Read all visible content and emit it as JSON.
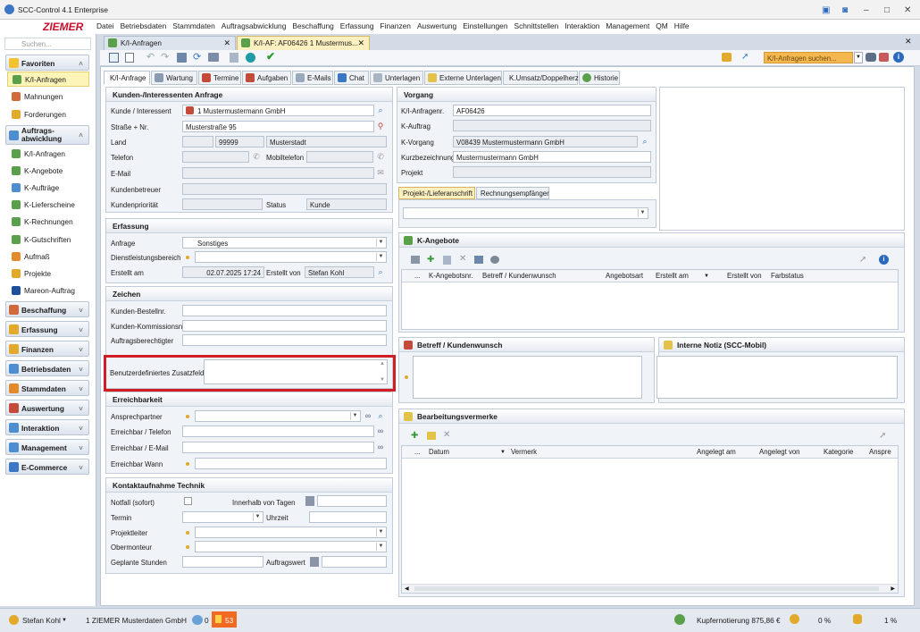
{
  "window": {
    "title": "SCC-Control 4.1 Enterprise"
  },
  "logo": "ZIEMER",
  "menu": [
    "Datei",
    "Betriebsdaten",
    "Stammdaten",
    "Auftragsabwicklung",
    "Beschaffung",
    "Erfassung",
    "Finanzen",
    "Auswertung",
    "Einstellungen",
    "Schnittstellen",
    "Interaktion",
    "Management",
    "QM",
    "Hilfe"
  ],
  "sidebar": {
    "search_placeholder": "Suchen...",
    "favoriten": "Favoriten",
    "fav_items": [
      "K/I-Anfragen",
      "Mahnungen",
      "Forderungen"
    ],
    "auftrag": "Auftrags-\nabwicklung",
    "auftrag_items": [
      "K/I-Anfragen",
      "K-Angebote",
      "K-Aufträge",
      "K-Lieferscheine",
      "K-Rechnungen",
      "K-Gutschriften",
      "Aufmaß",
      "Projekte",
      "Mareon-Auftrag"
    ],
    "groups": [
      "Beschaffung",
      "Erfassung",
      "Finanzen",
      "Betriebsdaten",
      "Stammdaten",
      "Auswertung",
      "Interaktion",
      "Management",
      "E-Commerce"
    ]
  },
  "doctabs": [
    "K/I-Anfragen",
    "K/I-AF: AF06426 1 Mustermus..."
  ],
  "toolbar": {
    "search_placeholder": "K/I-Anfragen suchen..."
  },
  "ptabs": [
    "K/I-Anfrage",
    "Wartung",
    "Termine",
    "Aufgaben",
    "E-Mails",
    "Chat",
    "Unterlagen",
    "Externe Unterlagen",
    "K.Umsatz/Doppelherz",
    "Historie"
  ],
  "kunde": {
    "title": "Kunden-/Interessenten Anfrage",
    "kunde_label": "Kunde / Interessent",
    "kunde_value": "1 Mustermustermann GmbH",
    "strasse_label": "Straße + Nr.",
    "strasse_value": "Musterstraße 95",
    "land_label": "Land",
    "plz": "99999",
    "ort": "Musterstadt",
    "telefon_label": "Telefon",
    "mobil_label": "Mobiltelefon",
    "email_label": "E-Mail",
    "betreuer_label": "Kundenbetreuer",
    "prio_label": "Kundenpriorität",
    "status_label": "Status",
    "status_value": "Kunde"
  },
  "erfassung": {
    "title": "Erfassung",
    "anfrage_label": "Anfrage",
    "anfrage_value": "Sonstiges",
    "dienst_label": "Dienstleistungsbereich",
    "erstellt_label": "Erstellt am",
    "erstellt_value": "02.07.2025 17:24",
    "erstellt_von_label": "Erstellt von",
    "erstellt_von_value": "Stefan Kohl"
  },
  "zeichen": {
    "title": "Zeichen",
    "bestell": "Kunden-Bestellnr.",
    "kommission": "Kunden-Kommissionsnr.",
    "auftragsb": "Auftragsberechtigter",
    "zusatz": "Benutzerdefiniertes Zusatzfeld"
  },
  "erreich": {
    "title": "Erreichbarkeit",
    "ansprech": "Ansprechpartner",
    "tel": "Erreichbar / Telefon",
    "mail": "Erreichbar / E-Mail",
    "wann": "Erreichbar Wann"
  },
  "kontakt": {
    "title": "Kontaktaufnahme Technik",
    "notfall": "Notfall (sofort)",
    "innerhalb": "Innerhalb von Tagen",
    "termin": "Termin",
    "uhrzeit": "Uhrzeit",
    "projektleiter": "Projektleiter",
    "obermonteur": "Obermonteur",
    "stunden": "Geplante Stunden",
    "auftragswert": "Auftragswert"
  },
  "vorgang": {
    "title": "Vorgang",
    "nr_label": "K/I-Anfragenr.",
    "nr_value": "AF06426",
    "auftrag_label": "K-Auftrag",
    "vorgang_label": "K-Vorgang",
    "vorgang_value": "V08439 Mustermustermann GmbH",
    "kurz_label": "Kurzbezeichnung",
    "kurz_value": "Mustermustermann GmbH",
    "projekt_label": "Projekt"
  },
  "addrtabs": [
    "Projekt-/Lieferanschrift",
    "Rechnungsempfänger"
  ],
  "angebote": {
    "title": "K-Angebote",
    "cols": [
      "...",
      "K-Angebotsnr.",
      "Betreff / Kundenwunsch",
      "Angebotsart",
      "Erstellt am",
      "Erstellt von",
      "Farbstatus"
    ]
  },
  "betreff": {
    "title": "Betreff / Kundenwunsch"
  },
  "notiz": {
    "title": "Interne Notiz (SCC-Mobil)"
  },
  "vermerke": {
    "title": "Bearbeitungsvermerke",
    "cols": [
      "...",
      "Datum",
      "Vermerk",
      "Angelegt am",
      "Angelegt von",
      "Kategorie",
      "Anspre"
    ]
  },
  "status": {
    "user": "Stefan Kohl",
    "company": "1 ZIEMER Musterdaten GmbH",
    "count1": "0",
    "count2": "53",
    "kupfer": "Kupfernotierung 875,86 €",
    "pct1": "0 %",
    "pct2": "1 %"
  }
}
